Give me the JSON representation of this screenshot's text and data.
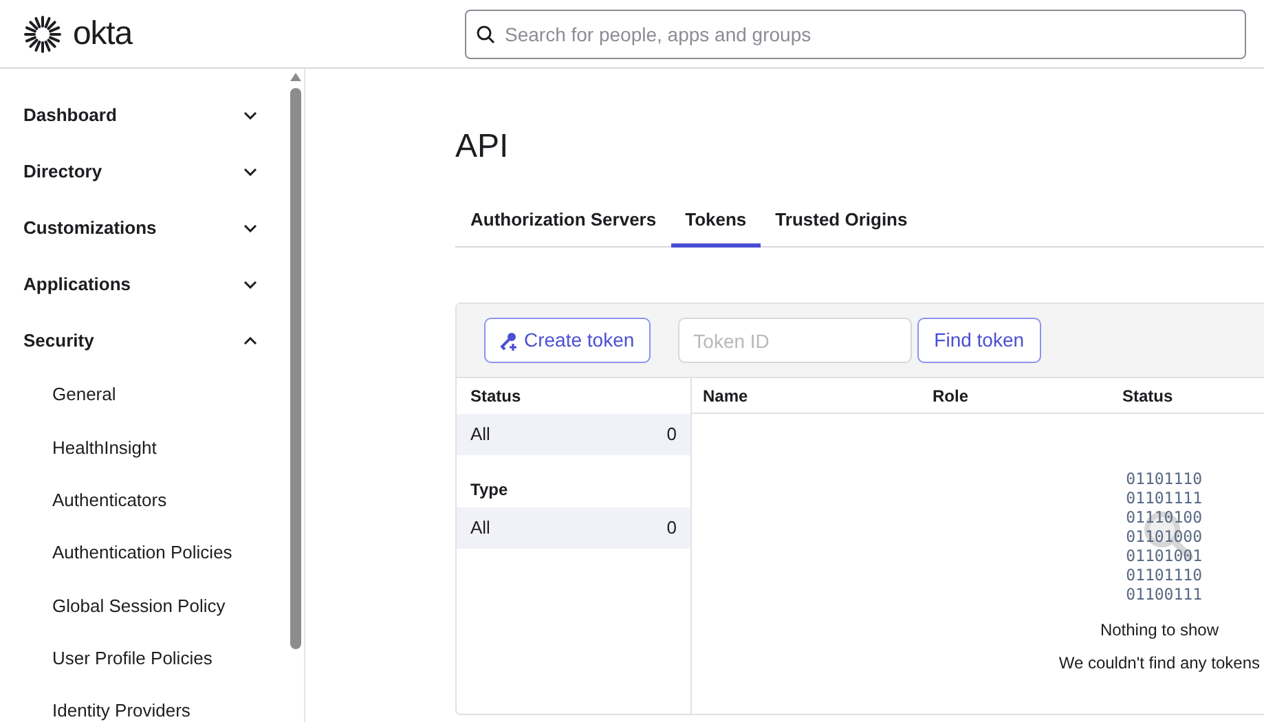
{
  "header": {
    "logo": "okta",
    "search": {
      "placeholder": "Search for people, apps and groups"
    }
  },
  "sidebar": {
    "items": [
      {
        "label": "Dashboard",
        "expanded": false
      },
      {
        "label": "Directory",
        "expanded": false
      },
      {
        "label": "Customizations",
        "expanded": false
      },
      {
        "label": "Applications",
        "expanded": false
      },
      {
        "label": "Security",
        "expanded": true,
        "children": [
          {
            "label": "General"
          },
          {
            "label": "HealthInsight"
          },
          {
            "label": "Authenticators"
          },
          {
            "label": "Authentication Policies"
          },
          {
            "label": "Global Session Policy"
          },
          {
            "label": "User Profile Policies"
          },
          {
            "label": "Identity Providers"
          }
        ]
      }
    ]
  },
  "page": {
    "title": "API",
    "tabs": [
      {
        "label": "Authorization Servers",
        "selected": false
      },
      {
        "label": "Tokens",
        "selected": true
      },
      {
        "label": "Trusted Origins",
        "selected": false
      }
    ],
    "toolbar": {
      "create_button": "Create token",
      "token_field": {
        "placeholder": "Token ID"
      },
      "find_button": "Find token"
    },
    "filters": [
      {
        "heading": "Status",
        "options": [
          {
            "label": "All",
            "count": "0",
            "selected": true
          }
        ]
      },
      {
        "heading": "Type",
        "options": [
          {
            "label": "All",
            "count": "0",
            "selected": true
          }
        ]
      }
    ],
    "table": {
      "columns": [
        "Name",
        "Role",
        "Status"
      ]
    },
    "empty_state": {
      "binary_lines": [
        "01101110",
        "01101111",
        "01110100",
        "01101000",
        "01101001",
        "01101110",
        "01100111"
      ],
      "title": "Nothing to show",
      "message": "We couldn't find any tokens"
    }
  }
}
